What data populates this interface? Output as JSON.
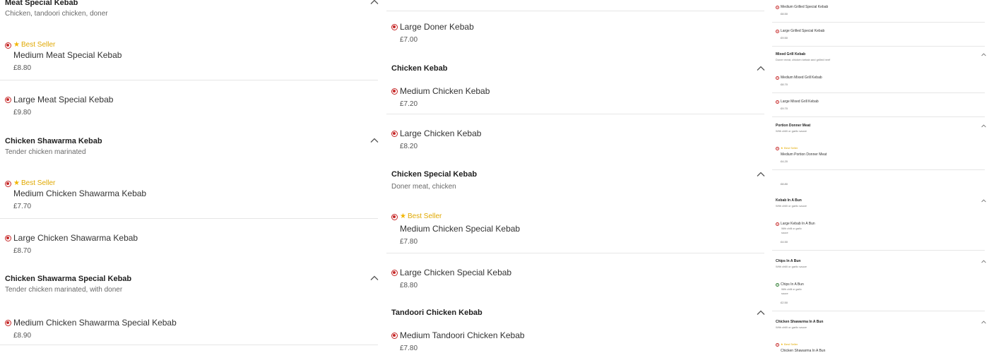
{
  "currency": "£",
  "colors": {
    "non_veg_dot": "#c62828",
    "veg_dot": "#2e7d32",
    "best_seller": "#e0a800"
  },
  "icons": {
    "collapse": "chevron-up-icon",
    "best_seller": "star-icon",
    "diet": "food-dot-icon"
  },
  "badges": {
    "best_seller": "Best Seller"
  },
  "col1": {
    "categories": [
      {
        "title": "Meat Special Kebab",
        "desc": "Chicken, tandoori chicken, doner",
        "items": [
          {
            "name": "Medium Meat Special Kebab",
            "price": "£8.80",
            "best_seller": true
          },
          {
            "name": "Large Meat Special Kebab",
            "price": "£9.80"
          }
        ]
      },
      {
        "title": "Chicken Shawarma Kebab",
        "desc": "Tender chicken marinated",
        "items": [
          {
            "name": "Medium Chicken Shawarma Kebab",
            "price": "£7.70",
            "best_seller": true
          },
          {
            "name": "Large Chicken Shawarma Kebab",
            "price": "£8.70"
          }
        ]
      },
      {
        "title": "Chicken Shawarma Special Kebab",
        "desc": "Tender chicken marinated, with doner",
        "items": [
          {
            "name": "Medium Chicken Shawarma Special Kebab",
            "price": "£8.90"
          }
        ]
      }
    ]
  },
  "col2": {
    "lead_items": [
      {
        "name": "Large Doner Kebab",
        "price": "£7.00"
      }
    ],
    "categories": [
      {
        "title": "Chicken Kebab",
        "desc": "",
        "items": [
          {
            "name": "Medium Chicken Kebab",
            "price": "£7.20"
          },
          {
            "name": "Large Chicken Kebab",
            "price": "£8.20"
          }
        ]
      },
      {
        "title": "Chicken Special Kebab",
        "desc": "Doner meat, chicken",
        "items": [
          {
            "name": "Medium Chicken Special Kebab",
            "price": "£7.80",
            "best_seller": true
          },
          {
            "name": "Large Chicken Special Kebab",
            "price": "£8.80"
          }
        ]
      },
      {
        "title": "Tandoori Chicken Kebab",
        "desc": "",
        "items": [
          {
            "name": "Medium Tandoori Chicken Kebab",
            "price": "£7.80"
          }
        ]
      }
    ]
  },
  "col3": {
    "lead_items": [
      {
        "name": "Medium Grilled Special Kebab",
        "price": "£8.50"
      },
      {
        "name": "Large Grilled Special Kebab",
        "price": "£9.50"
      }
    ],
    "categories": [
      {
        "title": "Mixed Grill Kebab",
        "desc": "Doner meat, chicken kebab and grilled beef",
        "items": [
          {
            "name": "Medium Mixed Grill Kebab",
            "price": "£8.70"
          },
          {
            "name": "Large Mixed Grill Kebab",
            "price": "£9.70"
          }
        ]
      },
      {
        "title": "Portion Donner Meat",
        "desc": "With chilli or garlic sauce",
        "items": [
          {
            "name": "Medium Portion Donner Meat",
            "price": "£4.20",
            "best_seller": true
          }
        ],
        "overlap_price": "£8.80"
      },
      {
        "title": "Kebab In A Bun",
        "desc": "With chilli or garlic sauce",
        "items": [
          {
            "name": "Large Kebab In A Bun",
            "desc_lines": [
              "With chilli or garlic",
              "sauce"
            ],
            "price": "£4.50"
          }
        ]
      },
      {
        "title": "Chips In A Bun",
        "desc": "With chilli or garlic sauce",
        "items": [
          {
            "name": "Chips In A Bun",
            "desc_lines": [
              "With chilli or garlic",
              "sauce"
            ],
            "price": "£2.50",
            "veg": true
          }
        ]
      },
      {
        "title": "Chicken Shawarma In A Bun",
        "desc": "With chilli or garlic sauce",
        "items": [
          {
            "name": "Chicken Shawarma In A Bun",
            "best_seller": true
          }
        ]
      }
    ]
  }
}
